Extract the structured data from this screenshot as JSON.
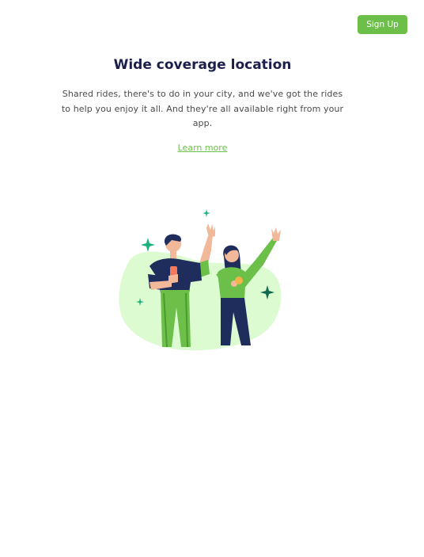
{
  "header": {
    "signup_label": "Sign Up"
  },
  "hero": {
    "title": "Wide coverage location",
    "description": "Shared rides, there's to do in your city, and we've got the rides to help you enjoy it all. And they're all available right from your app.",
    "learn_more_label": "Learn more"
  },
  "illustration": {
    "icon": "people-waving-illustration",
    "accent": "#6cc04a",
    "blob_color": "#dcfbd0",
    "navy": "#1e2d5c"
  },
  "colors": {
    "primary": "#6cc04a",
    "title": "#1b1f4a",
    "text": "#4a4a4a"
  }
}
